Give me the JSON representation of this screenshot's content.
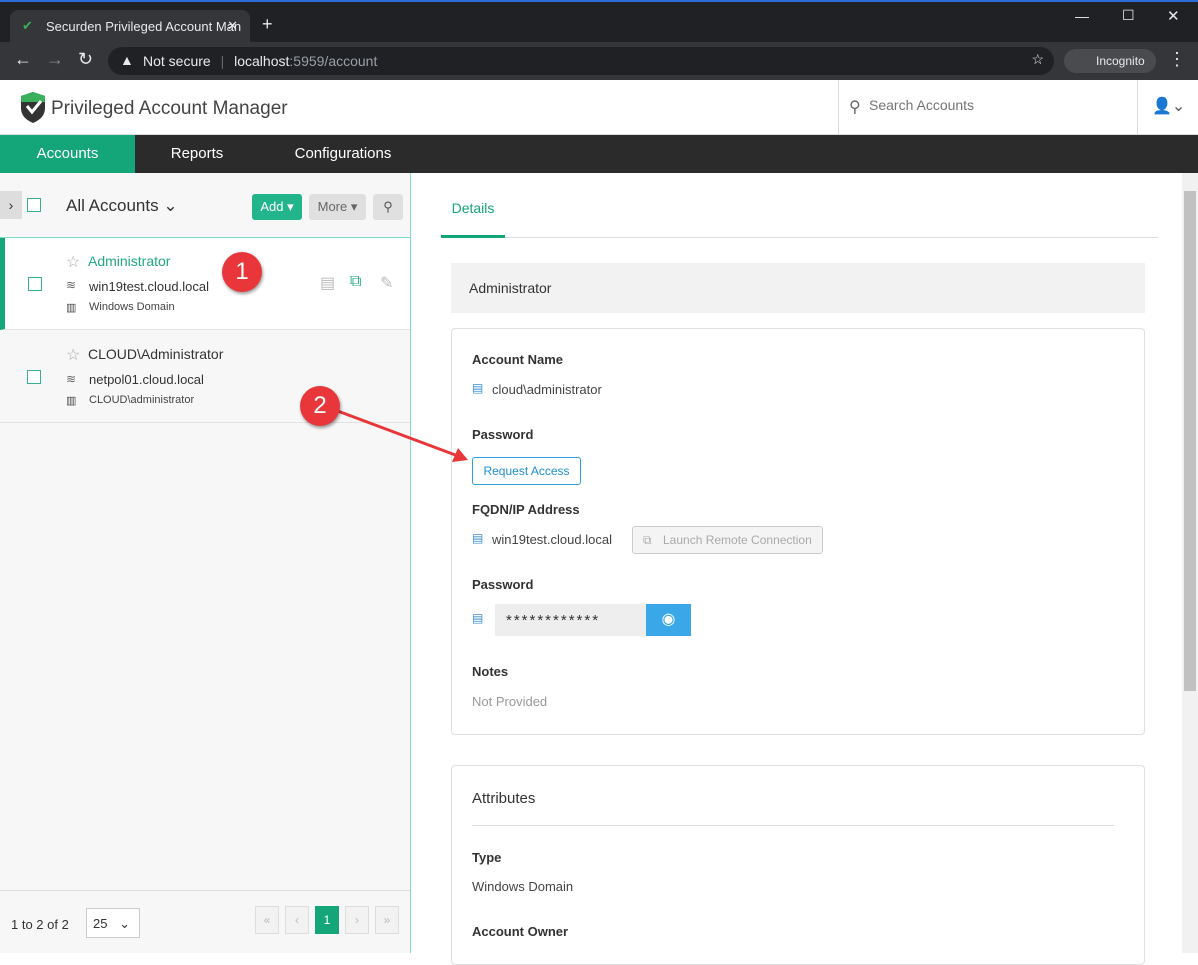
{
  "browser": {
    "tab_title": "Securden Privileged Account Man",
    "not_secure": "Not secure",
    "url_host": "localhost",
    "url_rest": ":5959/account",
    "incognito": "Incognito"
  },
  "app": {
    "title": "Privileged Account Manager",
    "search_placeholder": "Search Accounts"
  },
  "nav": [
    "Accounts",
    "Reports",
    "Configurations"
  ],
  "list": {
    "view": "All Accounts",
    "add": "Add",
    "more": "More",
    "items": [
      {
        "name": "Administrator",
        "host": "win19test.cloud.local",
        "type": "Windows Domain"
      },
      {
        "name": "CLOUD\\Administrator",
        "host": "netpol01.cloud.local",
        "type": "CLOUD\\administrator"
      }
    ],
    "count": "1 to 2 of 2",
    "page_size": "25",
    "page": "1"
  },
  "details": {
    "tab": "Details",
    "header": "Administrator",
    "account_name_label": "Account Name",
    "account_name": "cloud\\administrator",
    "password_label": "Password",
    "request_access": "Request Access",
    "fqdn_label": "FQDN/IP Address",
    "fqdn": "win19test.cloud.local",
    "launch": "Launch Remote Connection",
    "password2_label": "Password",
    "password_mask": "************",
    "notes_label": "Notes",
    "notes": "Not Provided",
    "attributes_title": "Attributes",
    "type_label": "Type",
    "type": "Windows Domain",
    "owner_label": "Account Owner"
  },
  "annotations": [
    "1",
    "2"
  ]
}
